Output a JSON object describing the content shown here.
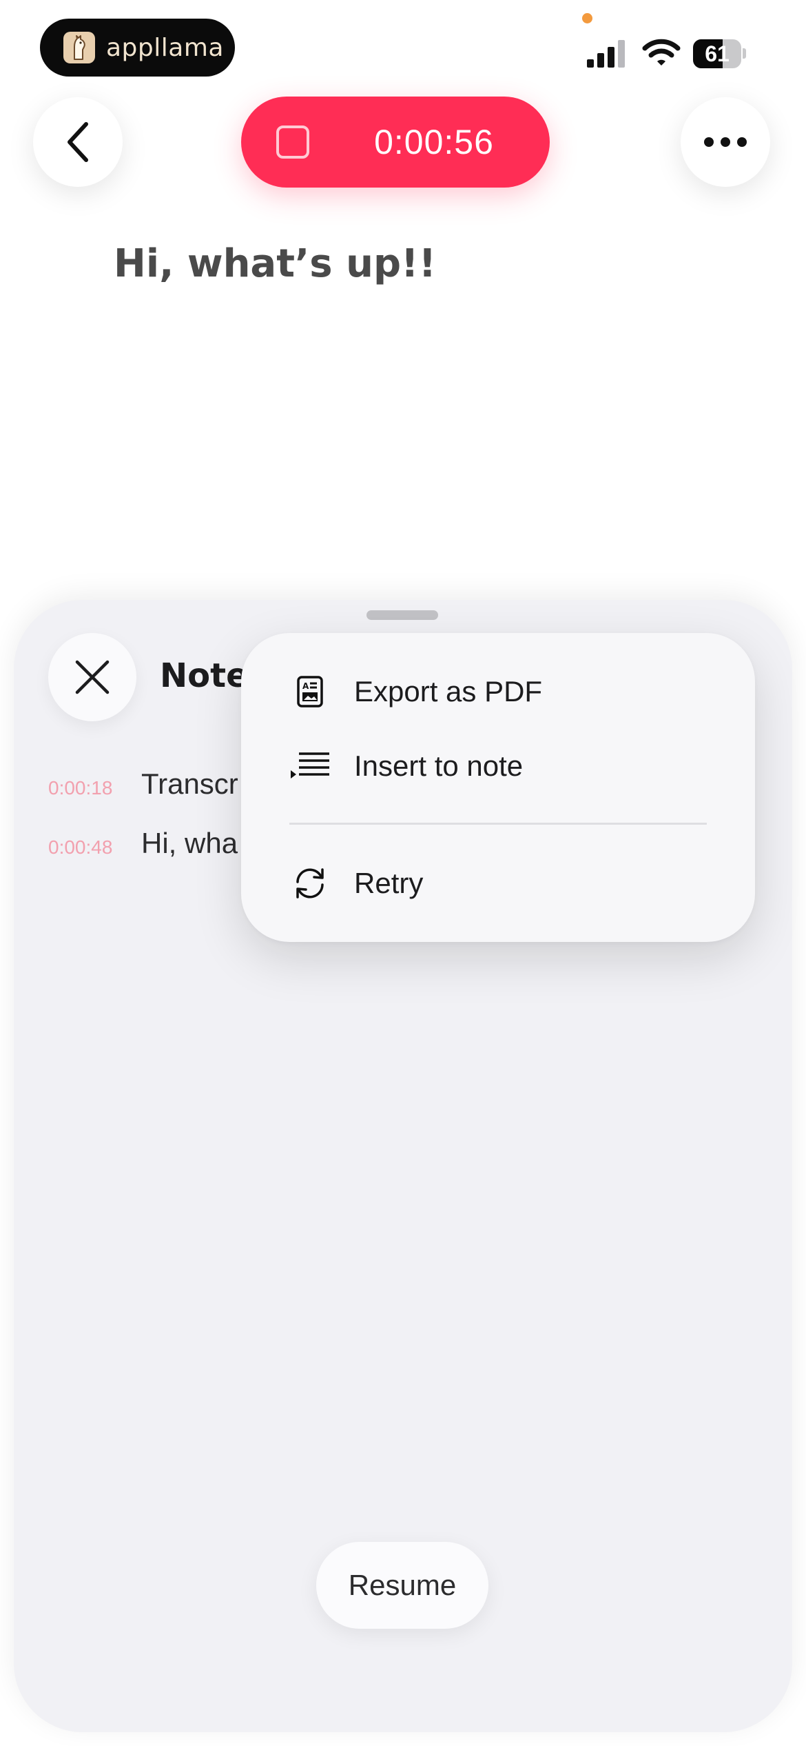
{
  "status_bar": {
    "brand_name": "appllama",
    "battery_level": "61",
    "battery_fraction": 0.61,
    "icons": [
      "recording-indicator-dot",
      "cellular-signal-icon",
      "wifi-icon",
      "battery-icon"
    ]
  },
  "header": {
    "timer": "0:00:56",
    "back_icon": "chevron-left-icon",
    "stop_icon": "stop-square-icon",
    "more_icon": "ellipsis-icon"
  },
  "note": {
    "title": "Hi, what’s up!!"
  },
  "sheet": {
    "title": "Note T",
    "close_icon": "close-icon",
    "segments": [
      {
        "time": "0:00:18",
        "text": "Transcr"
      },
      {
        "time": "0:00:48",
        "text": "Hi, wha"
      }
    ],
    "resume_label": "Resume"
  },
  "menu": {
    "items": [
      {
        "label": "Export as PDF",
        "icon": "document-pdf-icon"
      },
      {
        "label": "Insert to note",
        "icon": "insert-lines-icon"
      },
      {
        "label": "Retry",
        "icon": "retry-arrows-icon"
      }
    ]
  },
  "colors": {
    "record_red": "#ff2d55",
    "timestamp_pink": "#f2a0ae",
    "sheet_bg": "#f1f1f5",
    "dot_orange": "#f39a3e"
  }
}
